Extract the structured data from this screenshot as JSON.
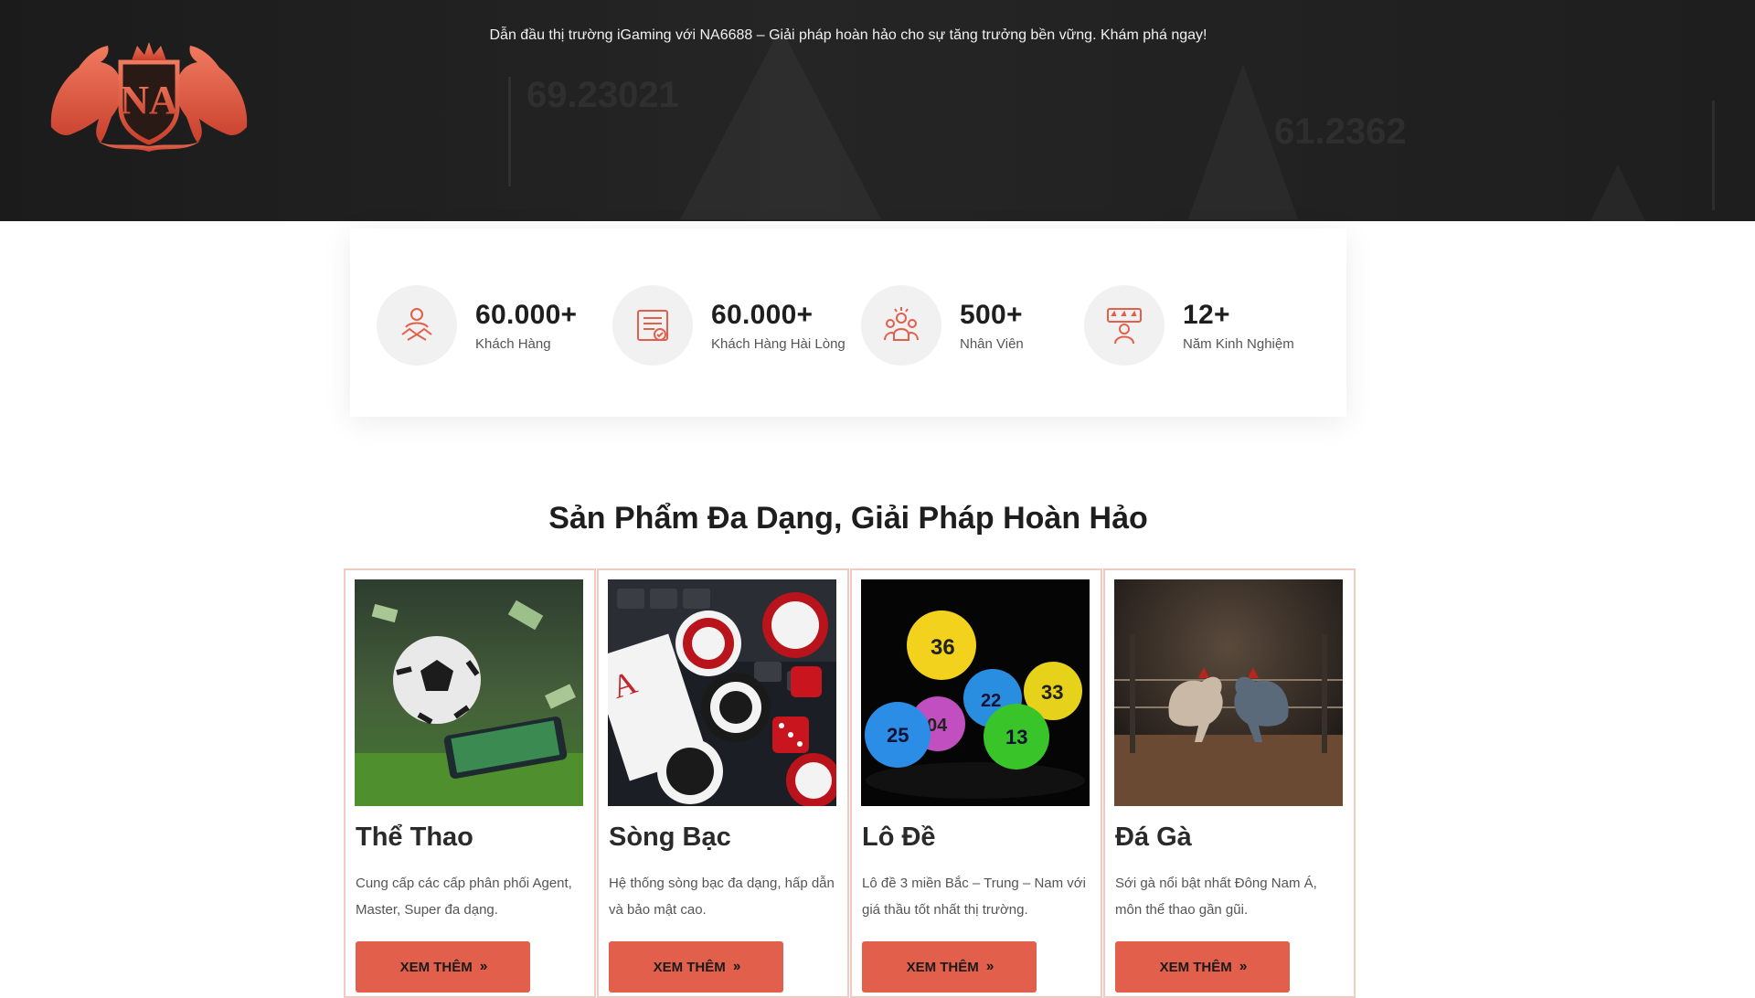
{
  "header": {
    "tagline": "Dẫn đầu thị trường iGaming với NA6688 – Giải pháp hoàn hảo cho sự tăng trưởng bền vững. Khám phá ngay!",
    "logo_text": "NA",
    "bg_values": [
      "69.23021",
      "61.2362"
    ]
  },
  "stats": [
    {
      "value": "60.000+",
      "label": "Khách Hàng",
      "icon": "handshake-icon"
    },
    {
      "value": "60.000+",
      "label": "Khách Hàng Hài Lòng",
      "icon": "checklist-icon"
    },
    {
      "value": "500+",
      "label": "Nhân Viên",
      "icon": "team-icon"
    },
    {
      "value": "12+",
      "label": "Năm Kinh Nghiệm",
      "icon": "rating-person-icon"
    }
  ],
  "section": {
    "title": "Sản Phẩm Đa Dạng, Giải Pháp Hoàn Hảo"
  },
  "products": [
    {
      "title": "Thể Thao",
      "desc": "Cung cấp các cấp phân phối Agent, Master, Super đa dạng.",
      "button": "XEM THÊM",
      "image": "football-image"
    },
    {
      "title": "Sòng Bạc",
      "desc": "Hệ thống sòng bạc đa dạng, hấp dẫn và bảo mật cao.",
      "button": "XEM THÊM",
      "image": "casino-chips-image"
    },
    {
      "title": "Lô Đề",
      "desc": "Lô đề 3 miền Bắc – Trung – Nam với giá thầu tốt nhất thị trường.",
      "button": "XEM THÊM",
      "image": "lottery-balls-image"
    },
    {
      "title": "Đá Gà",
      "desc": "Sới gà nổi bật nhất Đông Nam Á, môn thể thao gần gũi.",
      "button": "XEM THÊM",
      "image": "cockfight-image"
    }
  ],
  "colors": {
    "accent": "#e2604b",
    "card_border": "#f4c9c1",
    "hero_bg": "#1e1e1e"
  }
}
